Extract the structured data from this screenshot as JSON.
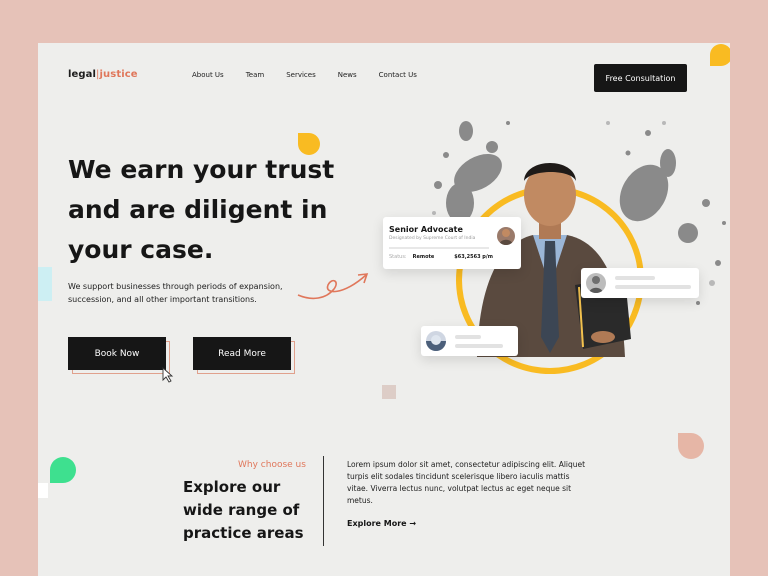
{
  "brand": {
    "part1": "legal",
    "separator": "|",
    "part2": "justice"
  },
  "nav": [
    "About Us",
    "Team",
    "Services",
    "News",
    "Contact Us"
  ],
  "header": {
    "cta_label": "Free Consultation"
  },
  "hero": {
    "title_lines": [
      "We earn your trust",
      "and are diligent in",
      "your case."
    ],
    "subtitle": "We support businesses through periods of expansion, succession, and all other important transitions.",
    "primary_button": "Book Now",
    "secondary_button": "Read More"
  },
  "advocate_card": {
    "role": "Senior Advocate",
    "designation": "Designated by Supreme Court of India",
    "status_label": "Status:",
    "status_value": "Remote",
    "rate": "$63,2563 p/m"
  },
  "practice": {
    "eyebrow": "Why choose us",
    "title": "Explore our wide range of practice areas",
    "body": "Lorem ipsum dolor sit amet, consectetur adipiscing elit. Aliquet turpis elit sodales tincidunt scelerisque libero iaculis mattis vitae. Viverra lectus nunc, volutpat lectus ac eget neque sit metus.",
    "link": "Explore More →"
  },
  "colors": {
    "accent": "#e0775b",
    "yellow": "#f9bb22",
    "green": "#3ee08f",
    "dark": "#161616",
    "background": "#e6c2b8",
    "canvas": "#eeeeec"
  }
}
